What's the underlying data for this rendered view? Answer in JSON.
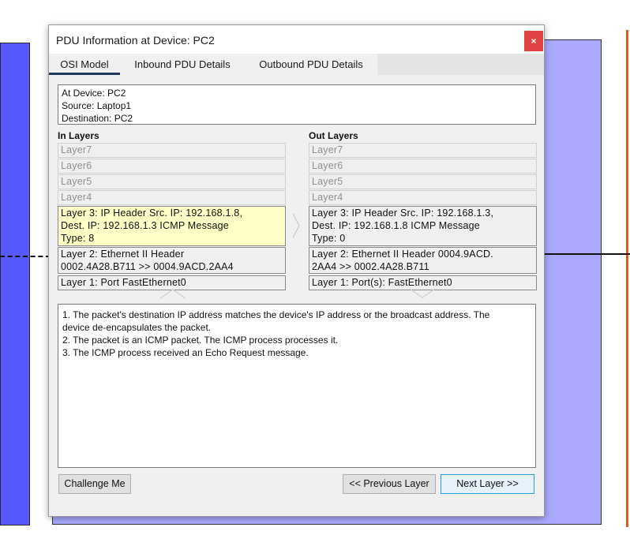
{
  "dialog": {
    "title": "PDU Information at Device: PC2",
    "close_label": "×"
  },
  "tabs": [
    {
      "label": "OSI Model",
      "active": true
    },
    {
      "label": "Inbound PDU Details",
      "active": false
    },
    {
      "label": "Outbound PDU Details",
      "active": false
    }
  ],
  "info": {
    "device": "At Device: PC2",
    "source": "Source: Laptop1",
    "destination": "Destination: PC2"
  },
  "in_layers": {
    "heading": "In Layers",
    "layer7": "Layer7",
    "layer6": "Layer6",
    "layer5": "Layer5",
    "layer4": "Layer4",
    "layer3": [
      "Layer 3: IP Header Src. IP: 192.168.1.8,",
      "Dest. IP: 192.168.1.3 ICMP Message",
      "Type: 8"
    ],
    "layer2": [
      "Layer 2: Ethernet II Header",
      "0002.4A28.B711 >> 0004.9ACD.2AA4"
    ],
    "layer1": "Layer 1: Port FastEthernet0"
  },
  "out_layers": {
    "heading": "Out Layers",
    "layer7": "Layer7",
    "layer6": "Layer6",
    "layer5": "Layer5",
    "layer4": "Layer4",
    "layer3": [
      "Layer 3: IP Header Src. IP: 192.168.1.3,",
      "Dest. IP: 192.168.1.8 ICMP Message",
      "Type: 0"
    ],
    "layer2": [
      "Layer 2: Ethernet II Header 0004.9ACD.",
      "2AA4 >> 0002.4A28.B711"
    ],
    "layer1": "Layer 1: Port(s): FastEthernet0"
  },
  "description": [
    "1. The packet's destination IP address matches the device's IP address or the broadcast address. The",
    "device de-encapsulates the packet.",
    "2. The packet is an ICMP packet. The ICMP process processes it.",
    "3. The ICMP process received an Echo Request message."
  ],
  "buttons": {
    "challenge": "Challenge Me",
    "previous": "<< Previous Layer",
    "next": "Next Layer >>"
  },
  "colors": {
    "highlight_layer": "#ffffc8",
    "close_button": "#e04343",
    "left_device": "#5858ff",
    "right_device": "#a9aaff",
    "link_orange": "#e15a1d"
  }
}
